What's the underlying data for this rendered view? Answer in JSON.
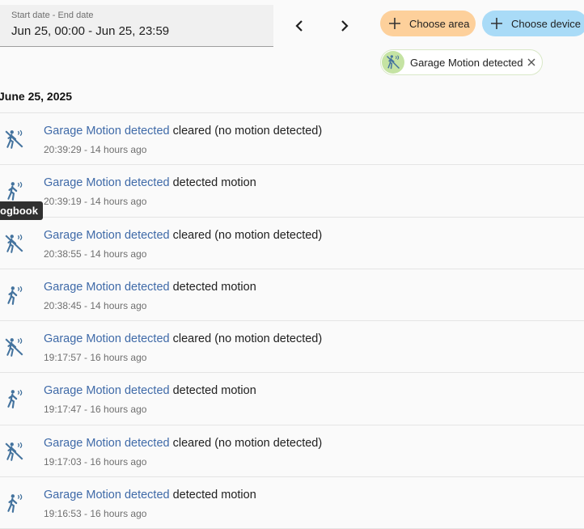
{
  "date_picker": {
    "label": "Start date - End date",
    "value": "Jun 25, 00:00 - Jun 25, 23:59"
  },
  "nav": {
    "prev_icon": "chevron-left-icon",
    "next_icon": "chevron-right-icon"
  },
  "chips": {
    "area": {
      "label": "Choose area",
      "color": "#fdd09b"
    },
    "device": {
      "label": "Choose device",
      "color": "#a9dbf7"
    }
  },
  "selected_entity": {
    "label": "Garage Motion detected",
    "avatar_color": "#c5e3a3"
  },
  "day_heading": "June 25, 2025",
  "tooltip": "ogbook",
  "entries": [
    {
      "entity": "Garage Motion detected",
      "message": " cleared (no motion detected)",
      "time": "20:39:29 - 14 hours ago",
      "state": "clear"
    },
    {
      "entity": "Garage Motion detected",
      "message": " detected motion",
      "time": "20:39:19 - 14 hours ago",
      "state": "motion"
    },
    {
      "entity": "Garage Motion detected",
      "message": " cleared (no motion detected)",
      "time": "20:38:55 - 14 hours ago",
      "state": "clear"
    },
    {
      "entity": "Garage Motion detected",
      "message": " detected motion",
      "time": "20:38:45 - 14 hours ago",
      "state": "motion"
    },
    {
      "entity": "Garage Motion detected",
      "message": " cleared (no motion detected)",
      "time": "19:17:57 - 16 hours ago",
      "state": "clear"
    },
    {
      "entity": "Garage Motion detected",
      "message": " detected motion",
      "time": "19:17:47 - 16 hours ago",
      "state": "motion"
    },
    {
      "entity": "Garage Motion detected",
      "message": " cleared (no motion detected)",
      "time": "19:17:03 - 16 hours ago",
      "state": "clear"
    },
    {
      "entity": "Garage Motion detected",
      "message": " detected motion",
      "time": "19:16:53 - 16 hours ago",
      "state": "motion"
    }
  ],
  "colors": {
    "link": "#3f6aa8",
    "icon": "#44739e"
  }
}
